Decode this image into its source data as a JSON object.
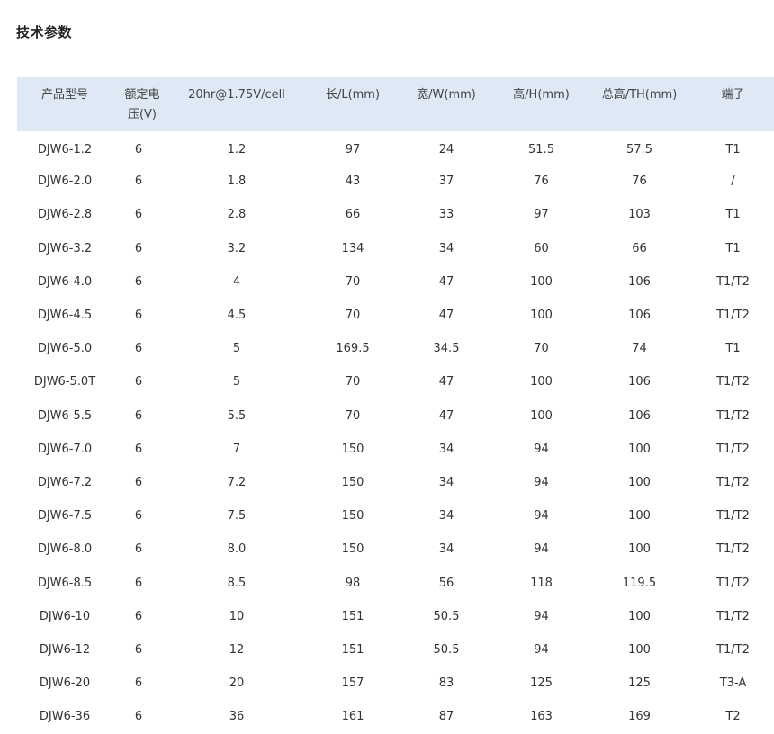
{
  "page": {
    "title": "技术参数"
  },
  "table": {
    "headers": [
      "产品型号",
      "额定电压(V)",
      "20hr@1.75V/cell",
      "长/L(mm)",
      "宽/W(mm)",
      "高/H(mm)",
      "总高/TH(mm)",
      "端子"
    ],
    "rows": [
      [
        "DJW6-1.2",
        "6",
        "1.2",
        "97",
        "24",
        "51.5",
        "57.5",
        "T1"
      ],
      [
        "DJW6-2.0",
        "6",
        "1.8",
        "43",
        "37",
        "76",
        "76",
        "/"
      ],
      [
        "DJW6-2.8",
        "6",
        "2.8",
        "66",
        "33",
        "97",
        "103",
        "T1"
      ],
      [
        "DJW6-3.2",
        "6",
        "3.2",
        "134",
        "34",
        "60",
        "66",
        "T1"
      ],
      [
        "DJW6-4.0",
        "6",
        "4",
        "70",
        "47",
        "100",
        "106",
        "T1/T2"
      ],
      [
        "DJW6-4.5",
        "6",
        "4.5",
        "70",
        "47",
        "100",
        "106",
        "T1/T2"
      ],
      [
        "DJW6-5.0",
        "6",
        "5",
        "169.5",
        "34.5",
        "70",
        "74",
        "T1"
      ],
      [
        "DJW6-5.0T",
        "6",
        "5",
        "70",
        "47",
        "100",
        "106",
        "T1/T2"
      ],
      [
        "DJW6-5.5",
        "6",
        "5.5",
        "70",
        "47",
        "100",
        "106",
        "T1/T2"
      ],
      [
        "DJW6-7.0",
        "6",
        "7",
        "150",
        "34",
        "94",
        "100",
        "T1/T2"
      ],
      [
        "DJW6-7.2",
        "6",
        "7.2",
        "150",
        "34",
        "94",
        "100",
        "T1/T2"
      ],
      [
        "DJW6-7.5",
        "6",
        "7.5",
        "150",
        "34",
        "94",
        "100",
        "T1/T2"
      ],
      [
        "DJW6-8.0",
        "6",
        "8.0",
        "150",
        "34",
        "94",
        "100",
        "T1/T2"
      ],
      [
        "DJW6-8.5",
        "6",
        "8.5",
        "98",
        "56",
        "118",
        "119.5",
        "T1/T2"
      ],
      [
        "DJW6-10",
        "6",
        "10",
        "151",
        "50.5",
        "94",
        "100",
        "T1/T2"
      ],
      [
        "DJW6-12",
        "6",
        "12",
        "151",
        "50.5",
        "94",
        "100",
        "T1/T2"
      ],
      [
        "DJW6-20",
        "6",
        "20",
        "157",
        "83",
        "125",
        "125",
        "T3-A"
      ],
      [
        "DJW6-36",
        "6",
        "36",
        "161",
        "87",
        "163",
        "169",
        "T2"
      ]
    ]
  },
  "colors": {
    "header_bg": "#dfe9f6",
    "text": "#333333",
    "title": "#222222"
  }
}
